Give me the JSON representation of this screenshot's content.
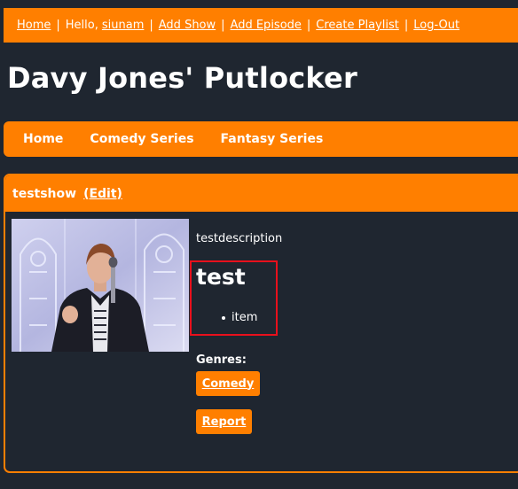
{
  "topnav": {
    "home": "Home",
    "sep": "|",
    "greeting": "Hello,",
    "username": "siunam",
    "add_show": "Add Show",
    "add_episode": "Add Episode",
    "create_playlist": "Create Playlist",
    "logout": "Log-Out"
  },
  "site": {
    "title": "Davy Jones' Putlocker"
  },
  "nav": {
    "items": [
      "Home",
      "Comedy Series",
      "Fantasy Series"
    ]
  },
  "show": {
    "title": "testshow",
    "edit_label": "(Edit)",
    "thumbnail_icon": "video-thumbnail-icon",
    "description": "testdescription",
    "content_heading": "test",
    "content_items": [
      "item"
    ],
    "genres_label": "Genres:",
    "genres": [
      "Comedy"
    ],
    "report_label": "Report"
  },
  "colors": {
    "accent": "#ff7f00",
    "background": "#1f2630",
    "highlight_border": "#e8101c"
  }
}
